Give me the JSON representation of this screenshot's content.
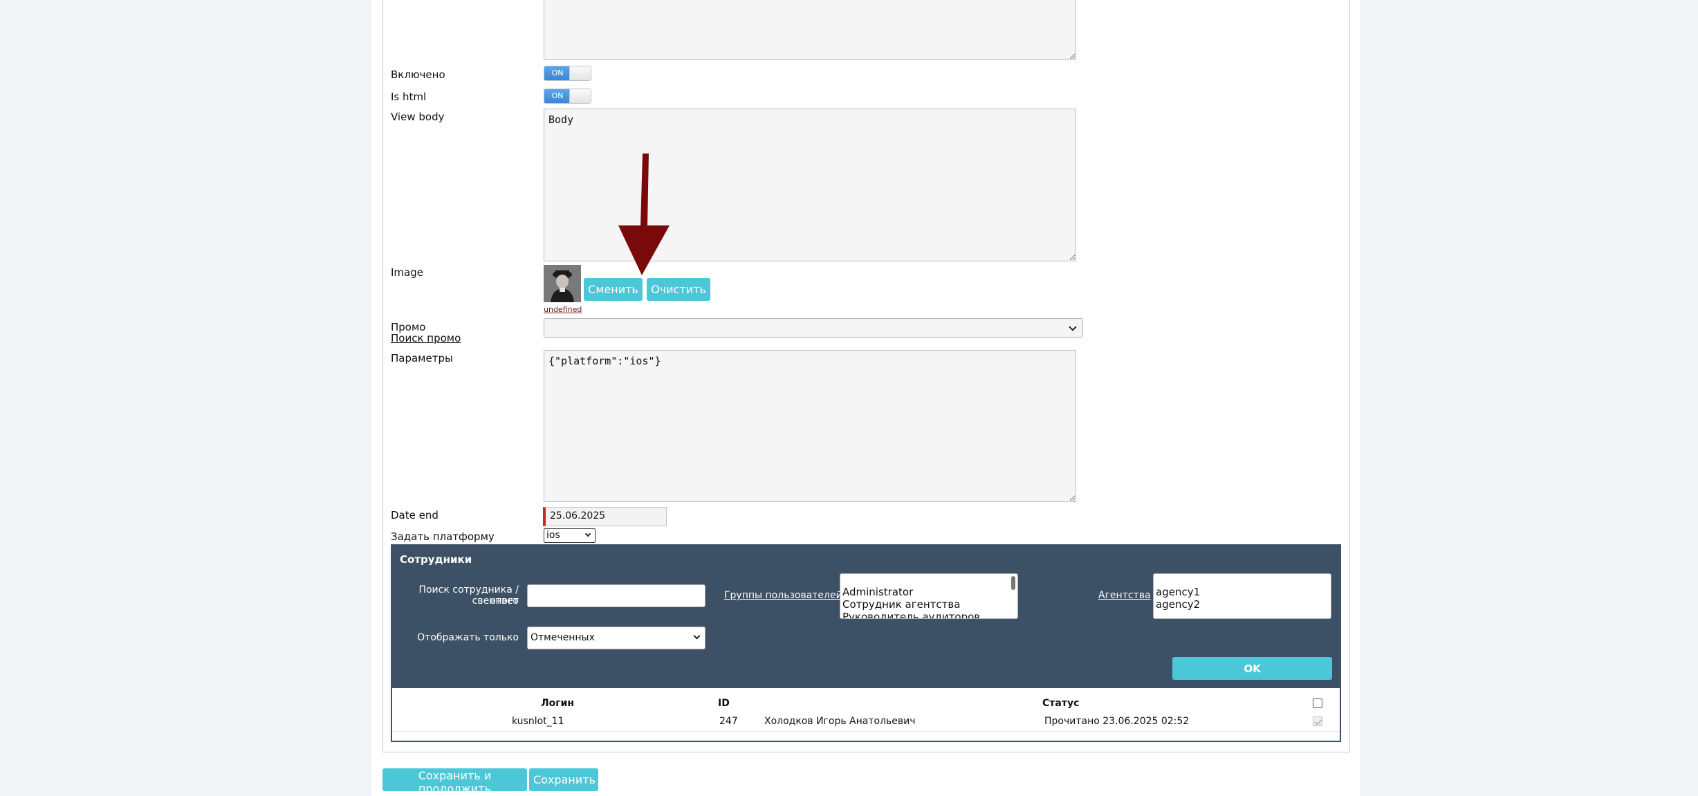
{
  "form": {
    "enabled_label": "Включено",
    "enabled_toggle": "ON",
    "is_html_label": "Is html",
    "is_html_toggle": "ON",
    "view_body_label": "View body",
    "view_body_value": "Body",
    "image_label": "Image",
    "image_change_button": "Сменить",
    "image_clear_button": "Очистить",
    "image_link": "undefined",
    "promo_label": "Промо",
    "promo_search_link": "Поиск промо",
    "params_label": "Параметры",
    "params_value": "{\"platform\":\"ios\"}",
    "date_end_label": "Date end",
    "date_end_value": "25.06.2025",
    "platform_label": "Задать платформу",
    "platform_value": "ios"
  },
  "employees": {
    "title": "Сотрудники",
    "search_label_line1": "Поиск сотрудника / ответ",
    "search_label_line2": "свенного",
    "user_groups_link": "Группы пользователей",
    "user_groups": [
      "Administrator",
      "Сотрудник агентства",
      "Руководитель аудиторов"
    ],
    "agencies_link": "Агентства",
    "agencies": [
      "agency1",
      "agency2"
    ],
    "show_only_label": "Отображать только",
    "show_only_value": "Отмеченных",
    "ok_button": "OK",
    "columns": {
      "login": "Логин",
      "id": "ID",
      "status": "Статус"
    },
    "rows": [
      {
        "login": "kusnlot_11",
        "id": "247",
        "name": "Холодков Игорь Анатольевич",
        "status": "Прочитано 23.06.2025 02:52"
      }
    ]
  },
  "footer": {
    "save_continue_button": "Сохранить и продолжить",
    "save_button": "Сохранить"
  },
  "colors": {
    "accent_cyan": "#4cc7d7",
    "dark_panel": "#3d5166",
    "toggle_on": "#3a86d6",
    "arrow": "#7a0a0a",
    "required_marker": "#c62828"
  }
}
